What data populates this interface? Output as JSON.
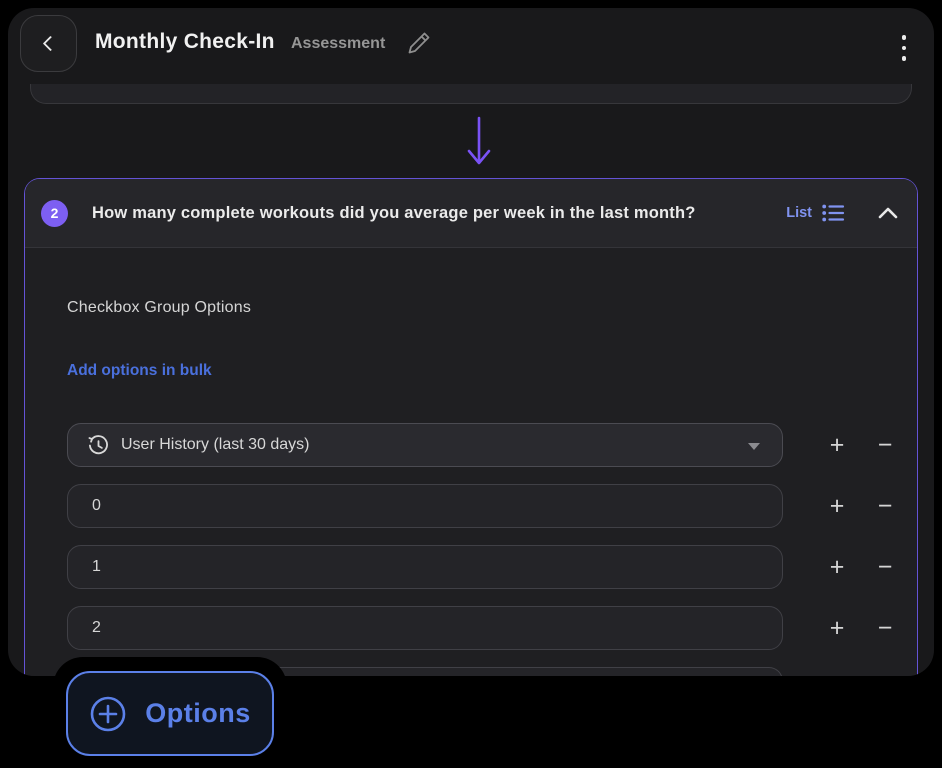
{
  "header": {
    "title": "Monthly Check-In",
    "subtitle": "Assessment",
    "back_icon": "chevron-left",
    "edit_icon": "pencil",
    "menu_icon": "kebab-menu"
  },
  "flow": {
    "connector": "arrow-down"
  },
  "question_card": {
    "number": "2",
    "question": "How many complete workouts did you average per week in the last month?",
    "type_label": "List",
    "type_icon": "bulleted-list",
    "collapse_icon": "chevron-up",
    "section_title": "Checkbox Group Options",
    "bulk_link_label": "Add options in bulk",
    "dropdown": {
      "icon": "history-clock",
      "value": "User History (last 30 days)"
    },
    "options": [
      "0",
      "1",
      "2"
    ],
    "row_actions": {
      "add": "+",
      "remove": "−"
    }
  },
  "options_button": {
    "icon": "plus-circle",
    "label": "Options"
  },
  "colors": {
    "accent_purple": "#7d5ff2",
    "card_border_purple": "#6453d6",
    "list_label_blue": "#8093f0",
    "link_blue": "#4a70dd",
    "options_blue": "#5b80e8"
  }
}
